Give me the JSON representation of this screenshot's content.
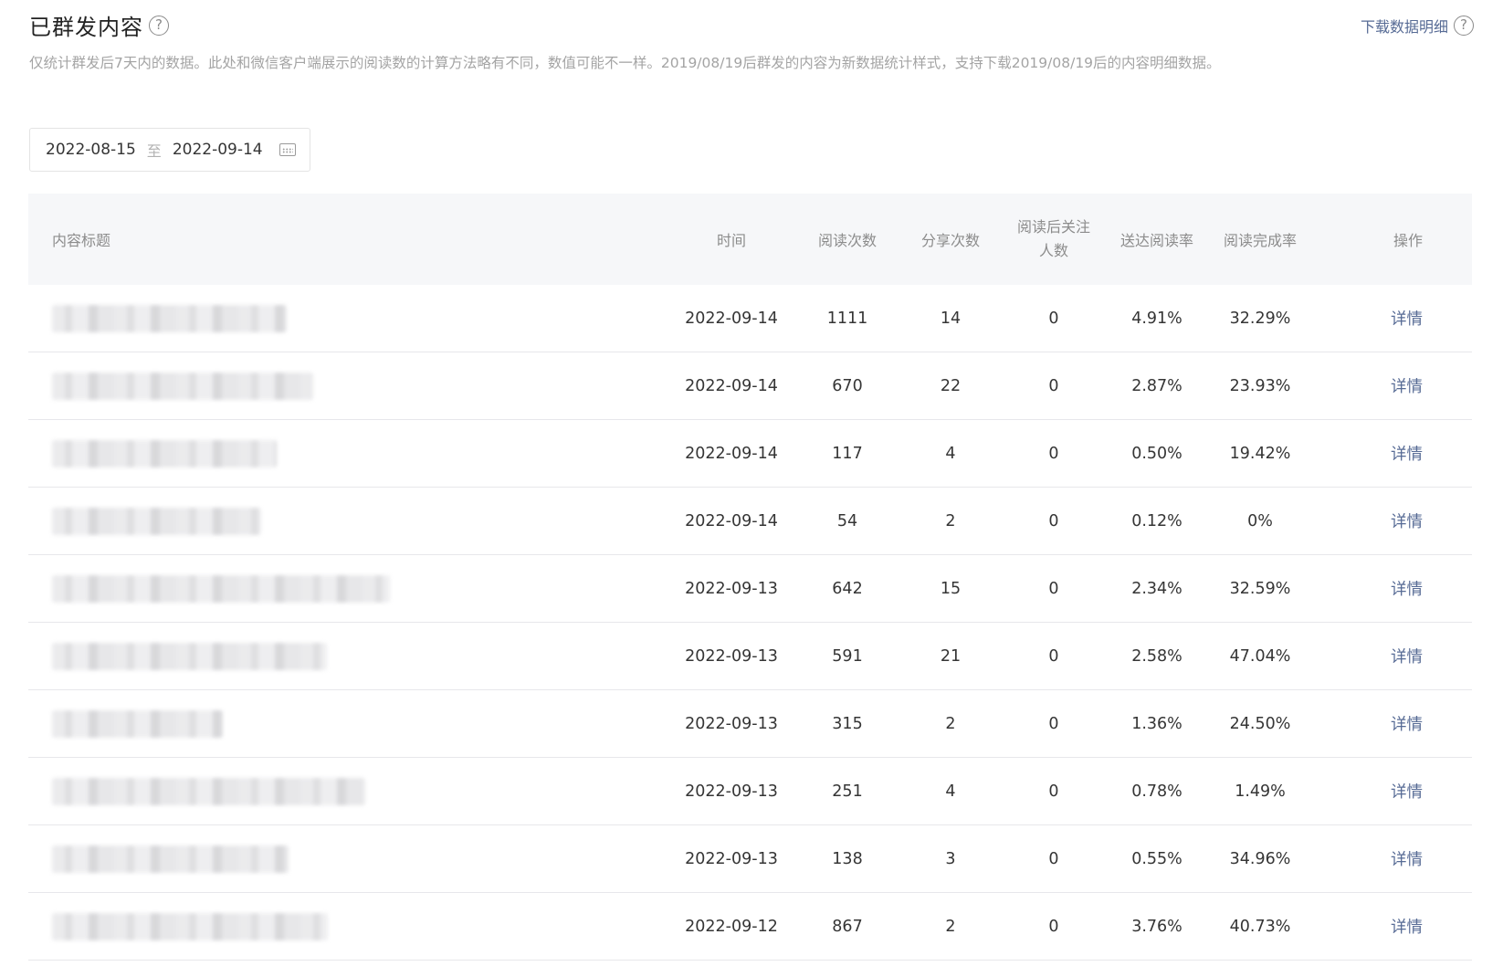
{
  "header": {
    "title": "已群发内容",
    "download_label": "下载数据明细",
    "help_icon": "?",
    "description": "仅统计群发后7天内的数据。此处和微信客户端展示的阅读数的计算方法略有不同，数值可能不一样。2019/08/19后群发的内容为新数据统计样式，支持下载2019/08/19后的内容明细数据。"
  },
  "date_filter": {
    "start": "2022-08-15",
    "separator": "至",
    "end": "2022-09-14",
    "icon": "calendar-icon"
  },
  "table": {
    "columns": {
      "title": "内容标题",
      "time": "时间",
      "reads": "阅读次数",
      "shares": "分享次数",
      "follows": "阅读后关注人数",
      "delivery_rate": "送达阅读率",
      "completion_rate": "阅读完成率",
      "action": "操作"
    },
    "rows": [
      {
        "date": "2022-09-14",
        "reads": "1111",
        "shares": "14",
        "follows": "0",
        "delivery_rate": "4.91%",
        "completion_rate": "32.29%",
        "action": "详情"
      },
      {
        "date": "2022-09-14",
        "reads": "670",
        "shares": "22",
        "follows": "0",
        "delivery_rate": "2.87%",
        "completion_rate": "23.93%",
        "action": "详情"
      },
      {
        "date": "2022-09-14",
        "reads": "117",
        "shares": "4",
        "follows": "0",
        "delivery_rate": "0.50%",
        "completion_rate": "19.42%",
        "action": "详情"
      },
      {
        "date": "2022-09-14",
        "reads": "54",
        "shares": "2",
        "follows": "0",
        "delivery_rate": "0.12%",
        "completion_rate": "0%",
        "action": "详情"
      },
      {
        "date": "2022-09-13",
        "reads": "642",
        "shares": "15",
        "follows": "0",
        "delivery_rate": "2.34%",
        "completion_rate": "32.59%",
        "action": "详情"
      },
      {
        "date": "2022-09-13",
        "reads": "591",
        "shares": "21",
        "follows": "0",
        "delivery_rate": "2.58%",
        "completion_rate": "47.04%",
        "action": "详情"
      },
      {
        "date": "2022-09-13",
        "reads": "315",
        "shares": "2",
        "follows": "0",
        "delivery_rate": "1.36%",
        "completion_rate": "24.50%",
        "action": "详情"
      },
      {
        "date": "2022-09-13",
        "reads": "251",
        "shares": "4",
        "follows": "0",
        "delivery_rate": "0.78%",
        "completion_rate": "1.49%",
        "action": "详情"
      },
      {
        "date": "2022-09-13",
        "reads": "138",
        "shares": "3",
        "follows": "0",
        "delivery_rate": "0.55%",
        "completion_rate": "34.96%",
        "action": "详情"
      },
      {
        "date": "2022-09-12",
        "reads": "867",
        "shares": "2",
        "follows": "0",
        "delivery_rate": "3.76%",
        "completion_rate": "40.73%",
        "action": "详情"
      }
    ]
  }
}
